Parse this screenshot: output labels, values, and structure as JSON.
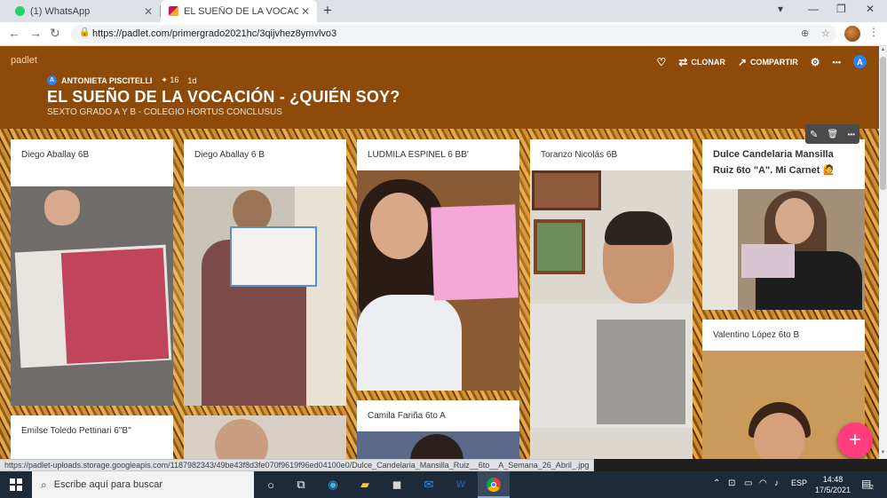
{
  "browser": {
    "tabs": [
      {
        "title": "(1) WhatsApp",
        "favicon_color": "#25d366",
        "active": false
      },
      {
        "title": "EL SUEÑO DE LA VOCACIÓN - ¿Q",
        "favicon_color": "#c2185b",
        "active": true
      }
    ],
    "close_glyph": "✕",
    "new_tab_glyph": "+",
    "window_controls": {
      "dropdown": "▾",
      "minimize": "—",
      "restore": "❐",
      "close": "✕"
    },
    "nav": {
      "back": "←",
      "forward": "→",
      "reload": "↻"
    },
    "url": "https://padlet.com/primergrado2021hc/3qijvhez8ymvlvo3",
    "status_url": "https://padlet-uploads.storage.googleapis.com/1187982343/49be43f8d3fe070f9619f96ed04100e0/Dulce_Candelaria_Mansilla_Ruiz__6to__A_Semana_26_Abril_.jpg",
    "icons": [
      "lock-icon",
      "install-icon",
      "star-icon",
      "profile-avatar",
      "menu-icon"
    ]
  },
  "padlet": {
    "brand": "padlet",
    "author": "ANTONIETA PISCITELLI",
    "author_initial": "A",
    "likes": "✦ 16",
    "age": "1d",
    "title": "EL SUEÑO DE LA VOCACIÓN - ¿QUIÉN SOY?",
    "subtitle": "SEXTO GRADO A Y B - COLEGIO HORTUS CONCLUSUS",
    "actions": {
      "heart": "♡",
      "clone": "CLONAR",
      "share": "COMPARTIR",
      "settings": "⚙",
      "more": "•••",
      "avatar": "A"
    },
    "float_tools": {
      "edit": "✎",
      "delete": "🗑",
      "more": "•••"
    },
    "fab": "+",
    "cards": [
      {
        "caption": "Diego Aballay 6B"
      },
      {
        "caption": "Diego Aballay 6 B"
      },
      {
        "caption": "LUDMILA ESPINEL 6 BB'"
      },
      {
        "caption": "Toranzo Nicolás 6B"
      },
      {
        "caption": "Dulce Candelaria Mansilla Ruiz 6to \"A\". Mi Carnet 🙋"
      },
      {
        "caption": "Valentino López 6to B"
      },
      {
        "caption": "Emilse Toledo Pettinari 6\"B\""
      },
      {
        "caption": "Camila Fariña 6to A"
      }
    ]
  },
  "taskbar": {
    "search_placeholder": "Escribe aquí para buscar",
    "language": "ESP",
    "time": "14:48",
    "date": "17/5/2021",
    "notifications": "2",
    "apps": [
      "cortana",
      "task-view",
      "edge",
      "file-explorer",
      "store",
      "mail",
      "word",
      "chrome"
    ]
  },
  "colors": {
    "header": "#8e4a08",
    "fab": "#ff3c7e",
    "avatar": "#2d7ff9",
    "taskbar": "#1c2a3a"
  }
}
